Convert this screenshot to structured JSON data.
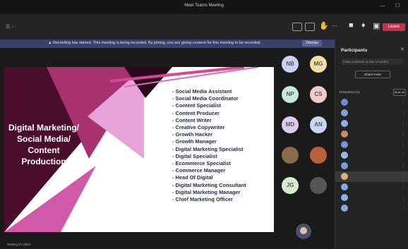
{
  "window": {
    "title": "Meet Teams Meeting"
  },
  "toolbar": {
    "leave_label": "Leave"
  },
  "banner": {
    "text": "▲ Recording has started. This meeting is being recorded. By joining, you are giving consent for this meeting to be recorded.",
    "dismiss_label": "Dismiss"
  },
  "slide": {
    "left_title": "Digital Marketing/ Social Media/ Content Production",
    "bullets": [
      "Social Media Assistant",
      "Social Media Coordinator",
      "Content Specialist",
      "Content Producer",
      "Content Writer",
      "Creative Copywriter",
      "Growth Hacker",
      "Growth Manager",
      "Digital Marketing Specialist",
      "Digital Specialist",
      "Ecommerce Specialist",
      "Commerce Manager",
      "Head Of Digital",
      "Digital Marketing Consultant",
      "Digital Marketing Manager",
      "Chief Marketing Officer"
    ]
  },
  "tiles": [
    {
      "initials": "NB",
      "color": "#c9d2ee"
    },
    {
      "initials": "MG",
      "color": "#f2dfa3"
    },
    {
      "initials": "NP",
      "color": "#c4ebd8"
    },
    {
      "initials": "CS",
      "color": "#f2c9cb"
    },
    {
      "initials": "MD",
      "color": "#d9ccef"
    },
    {
      "initials": "AN",
      "color": "#c7d6f2"
    },
    {
      "initials": "",
      "color": "#8a6b4a"
    },
    {
      "initials": "",
      "color": "#b86040"
    },
    {
      "initials": "JG",
      "color": "#d5ecd1"
    },
    {
      "initials": "",
      "color": "#555555"
    }
  ],
  "panel": {
    "title": "Participants",
    "share_label": "Share invite",
    "section_label": "Presenters (1)",
    "mute_all_label": "Mute all",
    "participants": [
      {
        "color": "#6b8cd6"
      },
      {
        "color": "#7aa0e0"
      },
      {
        "color": "#8ab0e8"
      },
      {
        "color": "#c88a6a"
      },
      {
        "color": "#6e9ad8"
      },
      {
        "color": "#9bb8ea"
      },
      {
        "color": "#7b9bd9"
      },
      {
        "color": "#e0b080"
      },
      {
        "color": "#7fa8e4"
      },
      {
        "color": "#86b2ec"
      },
      {
        "color": "#8aa5dc"
      }
    ]
  },
  "status": {
    "bottom_left": "Waiting for video"
  }
}
